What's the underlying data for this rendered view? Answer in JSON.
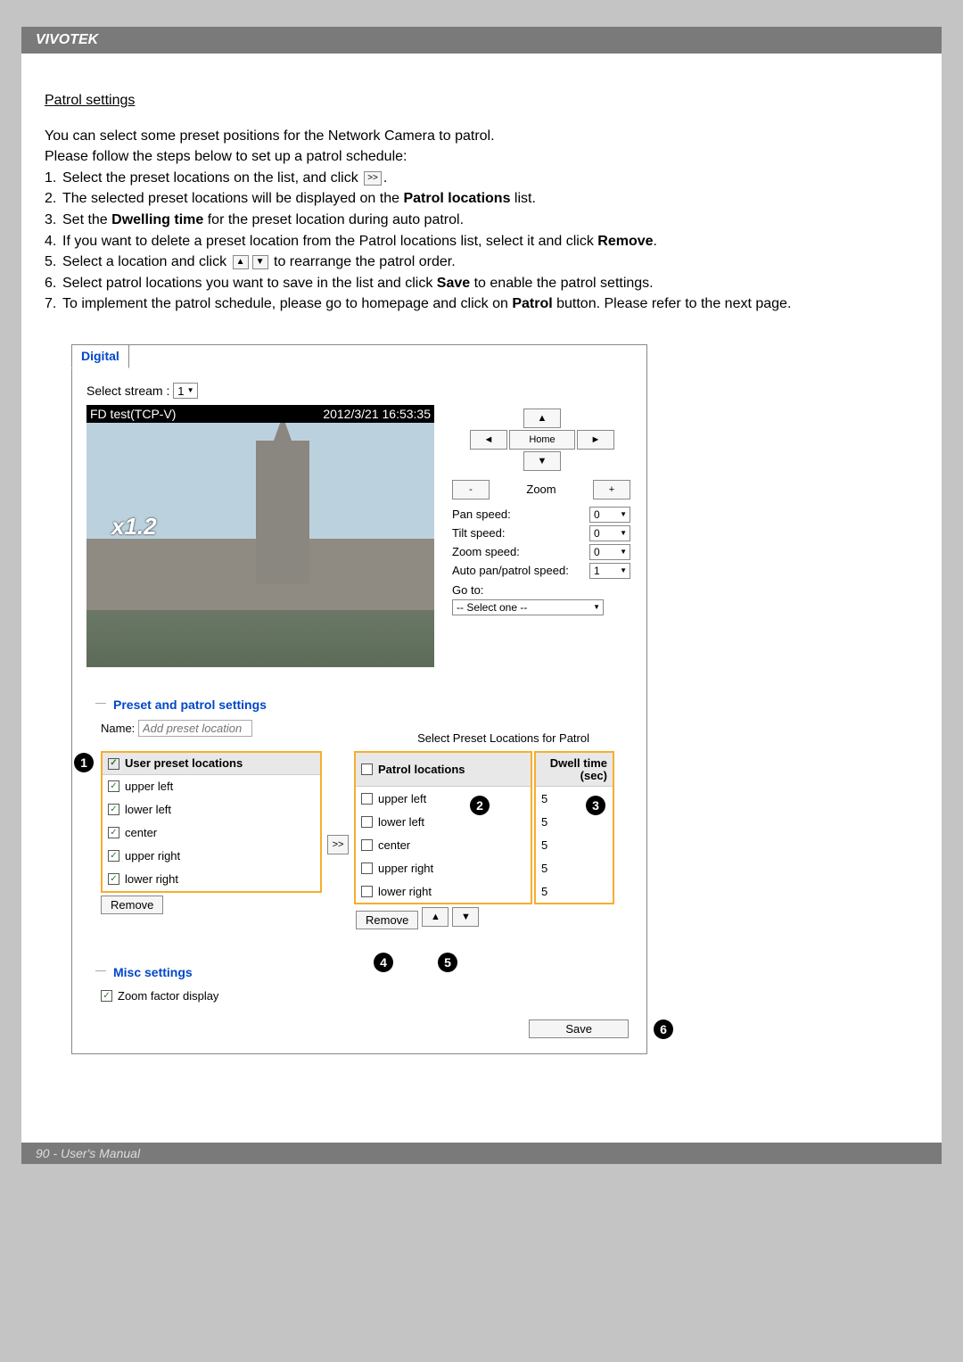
{
  "header": {
    "brand": "VIVOTEK"
  },
  "section_title": "Patrol settings",
  "intro": {
    "line1": "You can select some preset positions for the Network Camera to patrol.",
    "line2": "Please follow the steps below to set up a patrol schedule:"
  },
  "steps": {
    "s1a": "Select the preset locations on the list, and click ",
    "s1b": ".",
    "s2a": "The selected preset locations will be displayed on the ",
    "s2b": "Patrol locations",
    "s2c": " list.",
    "s3a": "Set the ",
    "s3b": "Dwelling time",
    "s3c": " for the preset location during auto patrol.",
    "s4a": "If you want to delete a preset location from the Patrol locations list, select it and click ",
    "s4b": "Remove",
    "s4c": ".",
    "s5a": "Select a location and click ",
    "s5b": " to rearrange the patrol order.",
    "s6a": "Select patrol locations you want to save in the list and click ",
    "s6b": "Save",
    "s6c": " to enable the patrol settings.",
    "s7a": "To implement the patrol schedule, please go to homepage and click on ",
    "s7b": "Patrol",
    "s7c": " button. Please refer to the next page."
  },
  "panel": {
    "tab": "Digital",
    "stream_label": "Select stream :",
    "stream_value": "1",
    "overlay_left": "FD test(TCP-V)",
    "overlay_right": "2012/3/21 16:53:35",
    "zoom_overlay": "x1.2",
    "controls": {
      "up": "▲",
      "down": "▼",
      "left": "◄",
      "right": "►",
      "home": "Home",
      "zoom_label": "Zoom",
      "zoom_minus": "-",
      "zoom_plus": "+",
      "pan_speed_label": "Pan speed:",
      "pan_speed": "0",
      "tilt_speed_label": "Tilt speed:",
      "tilt_speed": "0",
      "zoom_speed_label": "Zoom speed:",
      "zoom_speed": "0",
      "auto_speed_label": "Auto pan/patrol speed:",
      "auto_speed": "1",
      "goto_label": "Go to:",
      "goto_value": "-- Select one --"
    },
    "preset_legend": "Preset and patrol settings",
    "name_label": "Name:",
    "name_placeholder": "Add preset location",
    "select_patrol_label": "Select Preset Locations for Patrol",
    "user_preset_header": "User preset locations",
    "patrol_header": "Patrol locations",
    "dwell_header_l1": "Dwell time",
    "dwell_header_l2": "(sec)",
    "user_presets": [
      "upper left",
      "lower left",
      "center",
      "upper right",
      "lower right"
    ],
    "patrol_items": [
      "upper left",
      "lower left",
      "center",
      "upper right",
      "lower right"
    ],
    "dwell_values": [
      "5",
      "5",
      "5",
      "5",
      "5"
    ],
    "remove_label": "Remove",
    "misc_legend": "Misc settings",
    "misc_zoom_factor": "Zoom factor display",
    "save_label": "Save",
    "transfer_label": ">>"
  },
  "callouts": {
    "c1": "1",
    "c2": "2",
    "c3": "3",
    "c4": "4",
    "c5": "5",
    "c6": "6"
  },
  "footer": {
    "page": "90 - User's Manual"
  }
}
